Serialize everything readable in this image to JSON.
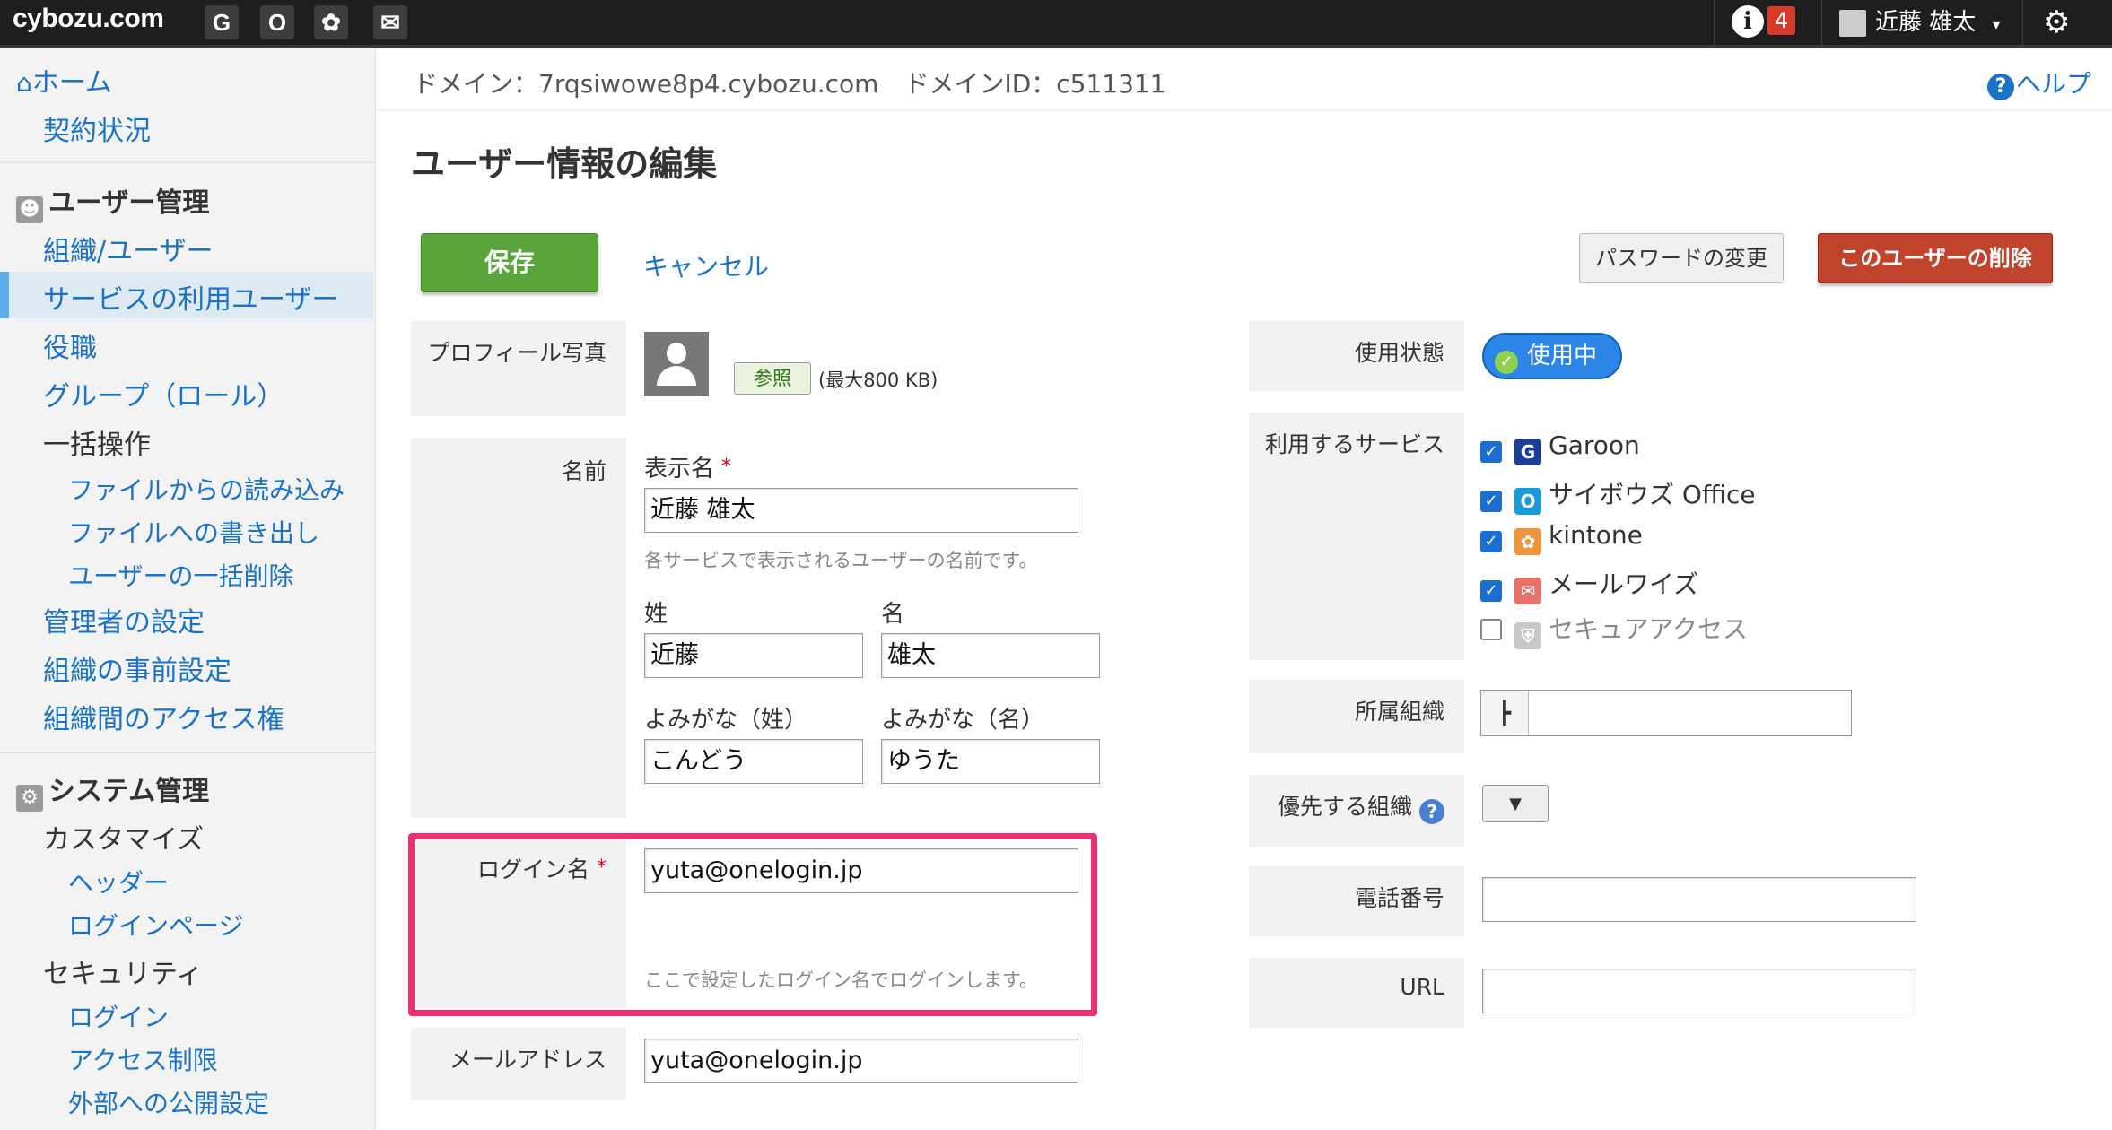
{
  "topbar": {
    "logo": "cybozu.com",
    "apps": [
      {
        "name": "garoon",
        "glyph": "G"
      },
      {
        "name": "office",
        "glyph": "O"
      },
      {
        "name": "kintone",
        "glyph": "✿"
      },
      {
        "name": "mailwise",
        "glyph": "✉"
      }
    ],
    "info_glyph": "i",
    "notification_count": "4",
    "user_name": "近藤 雄太",
    "user_caret": "▾",
    "gear_glyph": "⚙"
  },
  "sidebar": {
    "home": "ホーム",
    "contract": "契約状況",
    "user_mgmt_heading": "ユーザー管理",
    "items": [
      "組織/ユーザー",
      "サービスの利用ユーザー",
      "役職",
      "グループ（ロール）",
      "一括操作",
      "ファイルからの読み込み",
      "ファイルへの書き出し",
      "ユーザーの一括削除",
      "管理者の設定",
      "組織の事前設定",
      "組織間のアクセス権"
    ],
    "system_heading": "システム管理",
    "system_items": [
      "カスタマイズ",
      "ヘッダー",
      "ログインページ",
      "セキュリティ",
      "ログイン",
      "アクセス制限",
      "外部への公開設定"
    ]
  },
  "header": {
    "domain_text": "ドメイン：7rqsiwowe8p4.cybozu.com　ドメインID：c511311",
    "help": "ヘルプ",
    "title": "ユーザー情報の編集"
  },
  "actions": {
    "save": "保存",
    "cancel": "キャンセル",
    "change_password": "パスワードの変更",
    "delete_user": "このユーザーの削除"
  },
  "form": {
    "profile_photo_label": "プロフィール写真",
    "browse": "参照",
    "max_size": "(最大800 KB)",
    "name_label": "名前",
    "display_name_label": "表示名",
    "required_mark": "*",
    "display_name_value": "近藤 雄太",
    "display_name_hint": "各サービスで表示されるユーザーの名前です。",
    "last_name_label": "姓",
    "last_name_value": "近藤",
    "first_name_label": "名",
    "first_name_value": "雄太",
    "last_kana_label": "よみがな（姓）",
    "last_kana_value": "こんどう",
    "first_kana_label": "よみがな（名）",
    "first_kana_value": "ゆうた",
    "login_label": "ログイン名",
    "login_value": "yuta@onelogin.jp",
    "login_hint": "ここで設定したログイン名でログインします。",
    "email_label": "メールアドレス",
    "email_value": "yuta@onelogin.jp",
    "status_label": "使用状態",
    "status_value": "使用中",
    "services_label": "利用するサービス",
    "services": [
      {
        "name": "Garoon",
        "checked": true
      },
      {
        "name": "サイボウズ Office",
        "checked": true
      },
      {
        "name": "kintone",
        "checked": true
      },
      {
        "name": "メールワイズ",
        "checked": true
      },
      {
        "name": "セキュアアクセス",
        "checked": false
      }
    ],
    "org_label": "所属組織",
    "priority_org_label": "優先する組織",
    "phone_label": "電話番号",
    "url_label": "URL"
  },
  "colors": {
    "accent_blue": "#1a73c7",
    "save_green": "#5aa43b",
    "delete_red": "#c0432c",
    "highlight_pink": "#ee2f72"
  }
}
